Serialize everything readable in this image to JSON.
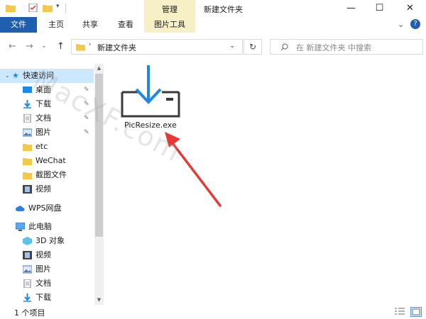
{
  "window": {
    "title": "新建文件夹",
    "context_tab": "管理",
    "minimize": "—",
    "maximize": "☐",
    "close": "✕"
  },
  "ribbon": {
    "tabs": [
      "文件",
      "主页",
      "共享",
      "查看",
      "图片工具"
    ],
    "expand": "⌄",
    "help": "?"
  },
  "address": {
    "back": "←",
    "forward": "→",
    "recent": "⌄",
    "up": "↑",
    "path": "新建文件夹",
    "dropdown": "⌄",
    "refresh": "↻",
    "search_placeholder": "在 新建文件夹 中搜索"
  },
  "nav": {
    "quick_access": "快速访问",
    "items": [
      {
        "label": "桌面",
        "pinned": true
      },
      {
        "label": "下载",
        "pinned": true
      },
      {
        "label": "文档",
        "pinned": true
      },
      {
        "label": "图片",
        "pinned": true
      },
      {
        "label": "etc",
        "pinned": false
      },
      {
        "label": "WeChat",
        "pinned": false
      },
      {
        "label": "截图文件",
        "pinned": false
      },
      {
        "label": "视频",
        "pinned": false
      }
    ],
    "wps": "WPS网盘",
    "this_pc": "此电脑",
    "pc_items": [
      "3D 对象",
      "视频",
      "图片",
      "文档",
      "下载"
    ],
    "pin_glyph": "✎"
  },
  "content": {
    "files": [
      {
        "name": "PicResize.exe"
      }
    ]
  },
  "status": {
    "count": "1 个项目"
  },
  "watermark": "MacXF.com",
  "colors": {
    "accent": "#1f5fae",
    "context_tab": "#f7efc5",
    "selected": "#cce8ff",
    "arrow": "#e53935",
    "download_arrow": "#1e88e5"
  }
}
